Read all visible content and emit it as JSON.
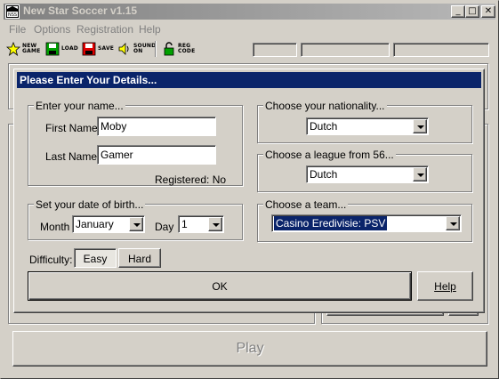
{
  "window": {
    "title": "New Star Soccer v1.15",
    "minimize_glyph": "_",
    "maximize_glyph": "□",
    "close_glyph": "✕"
  },
  "menu": {
    "items": [
      "File",
      "Options",
      "Registration",
      "Help"
    ]
  },
  "toolbar": {
    "new_game": [
      "NEW",
      "GAME"
    ],
    "load": [
      "LOAD"
    ],
    "save": [
      "SAVE"
    ],
    "sound": [
      "SOUND",
      "ON"
    ],
    "reg_code": [
      "REG",
      "CODE"
    ]
  },
  "play_button": "Play",
  "dialog": {
    "title": "Please Enter Your Details...",
    "name_group": {
      "title": "Enter your name...",
      "first_name_label": "First Name:",
      "first_name_value": "Moby",
      "last_name_label": "Last Name:",
      "last_name_value": "Gamer",
      "registered": "Registered: No"
    },
    "dob_group": {
      "title": "Set your date of birth...",
      "month_label": "Month",
      "month_value": "January",
      "day_label": "Day",
      "day_value": "1"
    },
    "nationality_group": {
      "title": "Choose your nationality...",
      "value": "Dutch"
    },
    "league_group": {
      "title": "Choose a league from 56...",
      "value": "Dutch"
    },
    "team_group": {
      "title": "Choose a team...",
      "value": "Casino Eredivisie: PSV"
    },
    "difficulty": {
      "label": "Difficulty:",
      "easy": "Easy",
      "hard": "Hard",
      "selected": "Easy"
    },
    "ok_button": "OK",
    "help_button": "Help"
  },
  "colors": {
    "dialog_title_bg": "#0a246a",
    "face": "#d4d0c8",
    "inactive_title": "#808080",
    "selection": "#0a246a"
  }
}
